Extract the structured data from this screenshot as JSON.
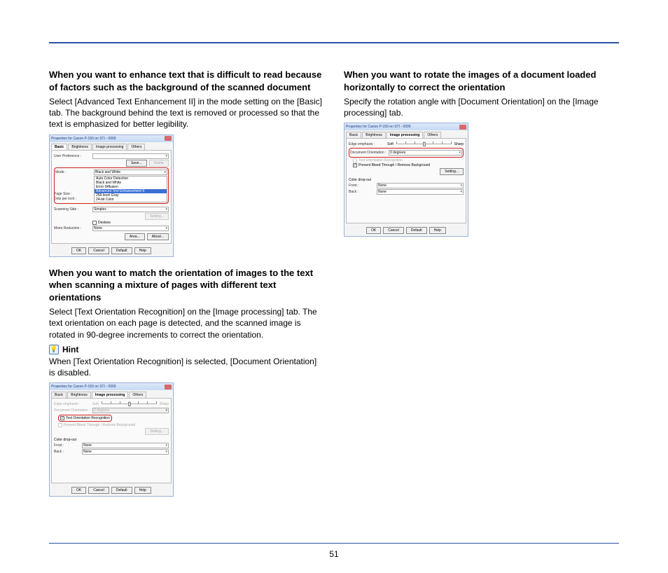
{
  "page_number": "51",
  "left": {
    "s1": {
      "heading": "When you want to enhance text that is difficult to read because of factors such as the background of the scanned document",
      "body": "Select [Advanced Text Enhancement II] in the mode setting on the [Basic] tab. The background behind the text is removed or processed so that the text is emphasized for better legibility."
    },
    "s2": {
      "heading": "When you want to match the orientation of images to the text when scanning a mixture of pages with different text orientations",
      "body": "Select [Text Orientation Recognition] on the [Image processing] tab. The text orientation on each page is detected, and the scanned image is rotated in 90-degree increments to correct the orientation."
    },
    "hint_label": "Hint",
    "hint_body": "When [Text Orientation Recognition] is selected, [Document Orientation] is disabled."
  },
  "right": {
    "s1": {
      "heading": "When you want to rotate the images of a document loaded horizontally to correct the orientation",
      "body": "Specify the rotation angle with [Document Orientation] on the [Image processing] tab."
    }
  },
  "dialog": {
    "title": "Properties for Canon P-150 on STI - 0000",
    "tabs": {
      "basic": "Basic",
      "brightness": "Brightness",
      "image": "Image processing",
      "others": "Others"
    },
    "labels": {
      "user_pref": "User Preference :",
      "save": "Save...",
      "delete": "Delete",
      "mode": "Mode :",
      "page_size": "Page Size :",
      "dpi": "Dots per inch :",
      "scanning_side": "Scanning Side :",
      "setting": "Setting...",
      "deskew": "Deskew",
      "moire": "Moire Reduction :",
      "area": "Area...",
      "about": "About...",
      "edge": "Edge emphasis :",
      "soft": "Soft",
      "sharp": "Sharp",
      "doc_orient": "Document Orientation :",
      "text_orient_rec": "Text Orientation Recognition",
      "prevent_bleed": "Prevent Bleed Through / Remove Background",
      "color_drop": "Color drop-out",
      "front": "Front :",
      "back": "Back :"
    },
    "values": {
      "zero_deg": "0 degrees",
      "none": "None",
      "simplex": "Simplex",
      "bw": "Black and White",
      "auto_color": "Auto Color Detection",
      "bw2": "Black and White",
      "error_diff": "Error Diffusion",
      "ate2": "Advanced Text Enhancement II",
      "gray256": "256-level Gray",
      "color24": "24-bit Color"
    },
    "buttons": {
      "ok": "OK",
      "cancel": "Cancel",
      "default": "Default",
      "help": "Help"
    }
  }
}
